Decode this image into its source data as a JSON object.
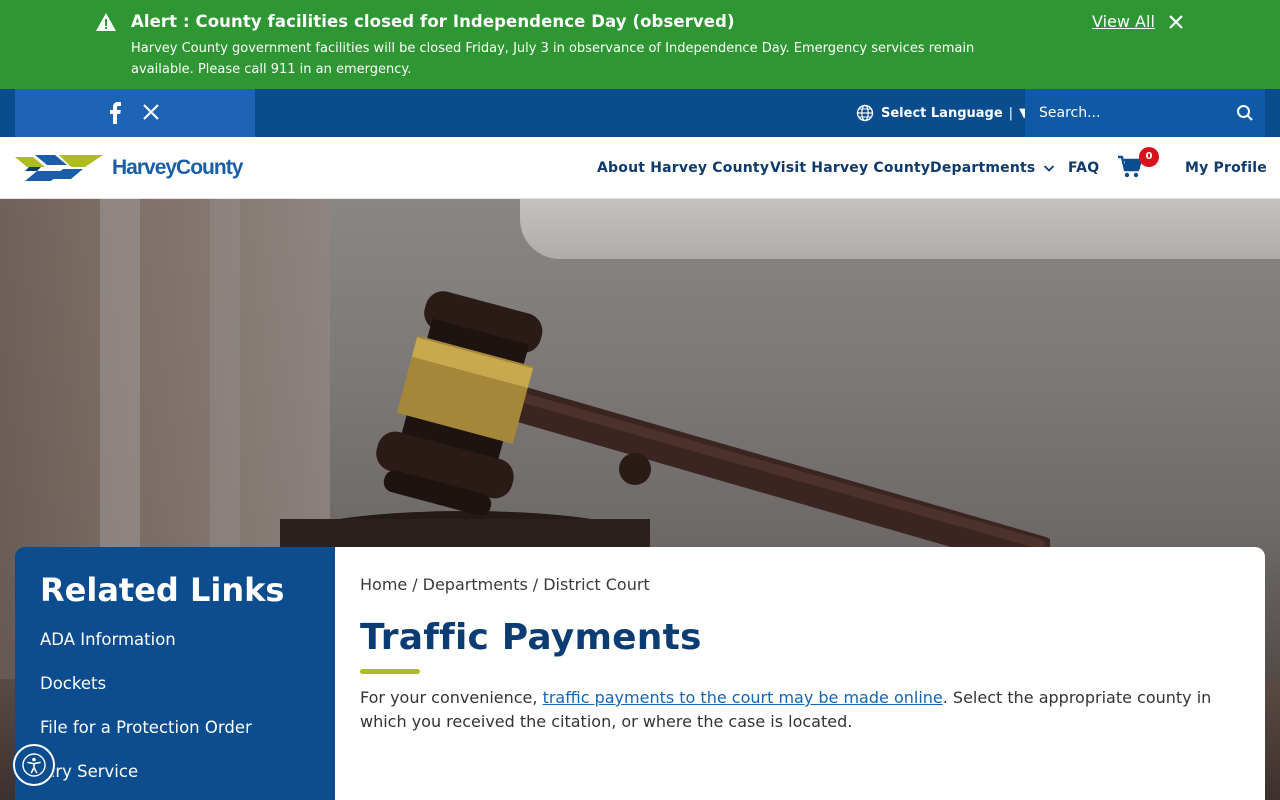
{
  "alert": {
    "title": "Alert : County facilities closed for Independence Day (observed)",
    "body": "Harvey County government facilities will be closed Friday, July 3 in observance of Independence Day. Emergency services remain available. Please call 911 in an emergency.",
    "view_all": "View All",
    "bg_color": "#2e9632"
  },
  "utility": {
    "language_label": "Select Language",
    "language_sep": "|",
    "language_arrow": "▼",
    "search_placeholder": "Search..."
  },
  "header": {
    "logo_text": "HarveyCounty",
    "nav": [
      {
        "label": "About Harvey County"
      },
      {
        "label": "Visit Harvey County"
      },
      {
        "label": "Departments"
      },
      {
        "label": "FAQ"
      },
      {
        "label": "My Profile"
      }
    ],
    "cart_count": "0"
  },
  "sidebar": {
    "title": "Related Links",
    "links": [
      {
        "label": "ADA Information"
      },
      {
        "label": "Dockets"
      },
      {
        "label": "File for a Protection Order"
      },
      {
        "label": "Jury Service"
      }
    ]
  },
  "content": {
    "breadcrumb": [
      {
        "label": "Home"
      },
      {
        "label": "Departments"
      },
      {
        "label": "District Court"
      }
    ],
    "breadcrumb_sep": "/",
    "title": "Traffic Payments",
    "para_before": "For your convenience, ",
    "para_link": "traffic payments to the court may be made online",
    "para_after": ". Select the appropriate county in which you received the citation, or where the case is located."
  },
  "colors": {
    "primary_blue": "#0b4d8f",
    "title_blue": "#0b3c73",
    "accent_green": "#aebd1d",
    "badge_red": "#d8131b"
  }
}
